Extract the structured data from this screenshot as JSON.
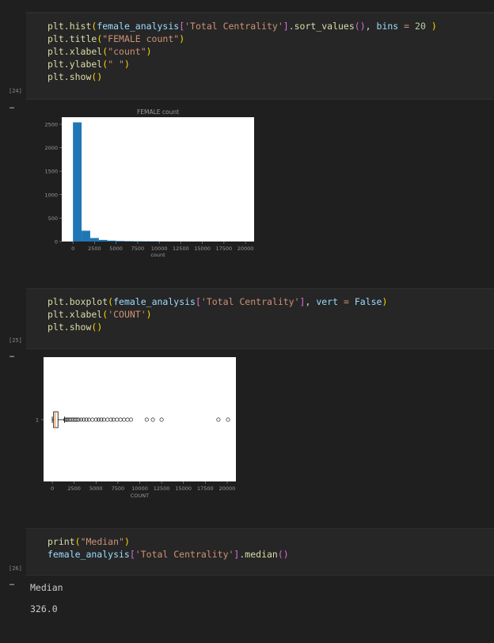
{
  "cells": [
    {
      "exec_count": "[24]",
      "code_lines": [
        "plt.hist(female_analysis['Total Centrality'].sort_values(), bins = 20 )",
        "plt.title(\"FEMALE count\")",
        "plt.xlabel(\"count\")",
        "plt.ylabel(\" \")",
        "plt.show()"
      ]
    },
    {
      "exec_count": "[25]",
      "code_lines": [
        "plt.boxplot(female_analysis['Total Centrality'], vert = False)",
        "plt.xlabel('COUNT')",
        "plt.show()"
      ]
    },
    {
      "exec_count": "[26]",
      "code_lines": [
        "print(\"Median\")",
        "female_analysis['Total Centrality'].median()"
      ]
    }
  ],
  "output_ellipsis": "…",
  "outputs": {
    "median_label": "Median",
    "median_value": "326.0"
  },
  "chart_data": [
    {
      "type": "bar",
      "title": "FEMALE count",
      "xlabel": "count",
      "ylabel": "",
      "xlim": [
        -1300,
        21000
      ],
      "ylim": [
        0,
        2650
      ],
      "xticks": [
        0,
        2500,
        5000,
        7500,
        10000,
        12500,
        15000,
        17500,
        20000
      ],
      "yticks": [
        0,
        500,
        1000,
        1500,
        2000,
        2500
      ],
      "bin_edges": [
        0,
        1000,
        2000,
        3000,
        4000,
        5000,
        6000,
        7000,
        8000,
        9000,
        10000,
        11000,
        12000,
        13000,
        14000,
        15000,
        16000,
        17000,
        18000,
        19000,
        20000
      ],
      "values": [
        2540,
        230,
        75,
        35,
        20,
        12,
        8,
        6,
        5,
        4,
        2,
        1,
        1,
        0,
        0,
        0,
        0,
        0,
        1,
        1
      ],
      "color": "#1f77b4"
    },
    {
      "type": "boxplot",
      "xlabel": "COUNT",
      "ylabel": "",
      "xlim": [
        -1000,
        21000
      ],
      "xticks": [
        0,
        2500,
        5000,
        7500,
        10000,
        12500,
        15000,
        17500,
        20000
      ],
      "ytick_labels": [
        "1"
      ],
      "q1": 150,
      "median": 326,
      "q3": 650,
      "whisker_low": 0,
      "whisker_high": 1400,
      "outliers": [
        1500,
        1650,
        1800,
        2000,
        2200,
        2400,
        2600,
        2800,
        3000,
        3300,
        3600,
        3900,
        4200,
        4600,
        5000,
        5300,
        5600,
        5900,
        6300,
        6700,
        7000,
        7400,
        7800,
        8200,
        8600,
        9000,
        10800,
        11500,
        12500,
        19000,
        20100
      ],
      "box_color": "#ff7f0e"
    }
  ]
}
